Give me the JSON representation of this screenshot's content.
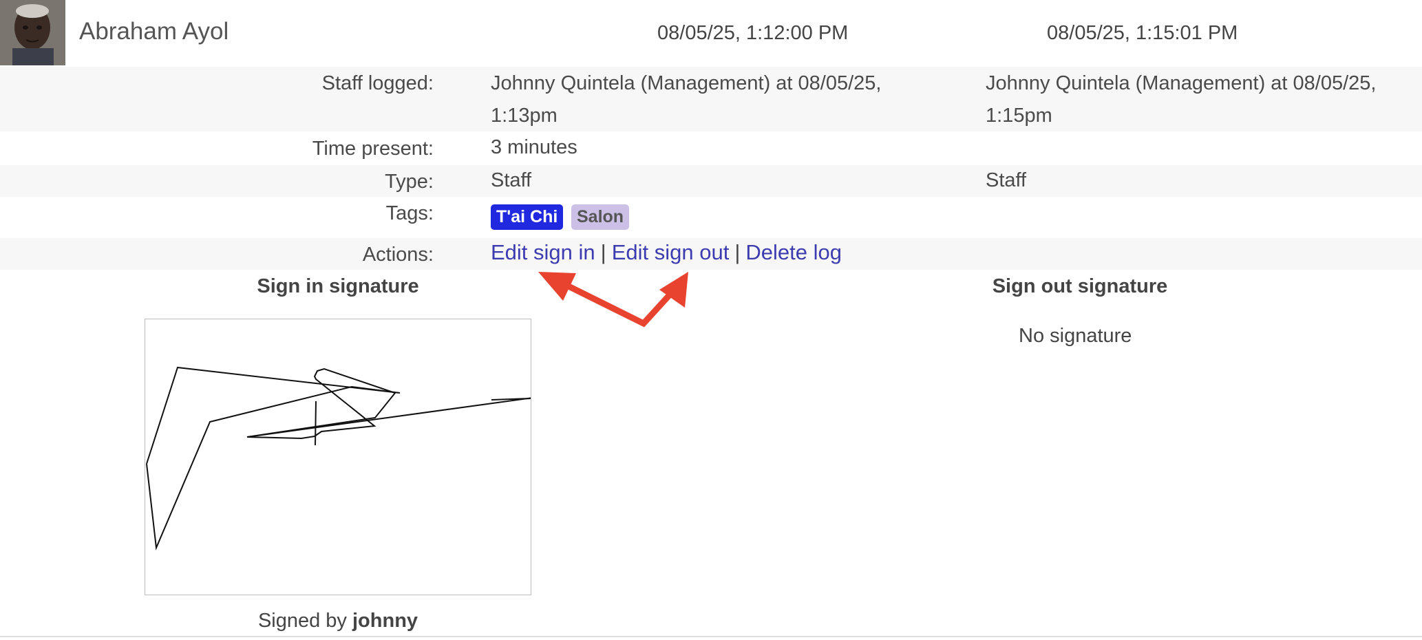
{
  "person": {
    "name": "Abraham Ayol",
    "sign_in_time": "08/05/25, 1:12:00 PM",
    "sign_out_time": "08/05/25, 1:15:01 PM"
  },
  "details": {
    "staff_logged_label": "Staff logged:",
    "staff_logged_in_line1": "Johnny Quintela (Management) at 08/05/25,",
    "staff_logged_in_line2": "1:13pm",
    "staff_logged_out_line1": "Johnny Quintela (Management) at 08/05/25,",
    "staff_logged_out_line2": "1:15pm",
    "time_present_label": "Time present:",
    "time_present_value": "3 minutes",
    "type_label": "Type:",
    "type_in": "Staff",
    "type_out": "Staff",
    "tags_label": "Tags:",
    "tags": [
      "T'ai Chi",
      "Salon"
    ],
    "actions_label": "Actions:",
    "actions": {
      "edit_sign_in": "Edit sign in",
      "edit_sign_out": "Edit sign out",
      "delete_log": "Delete log",
      "separator": "|"
    }
  },
  "signatures": {
    "sign_in_heading": "Sign in signature",
    "sign_out_heading": "Sign out signature",
    "signed_by_prefix": "Signed by",
    "signed_by_user": "johnny",
    "no_signature": "No signature"
  },
  "colors": {
    "link": "#3c3cb0",
    "tag_tai_chi": "#2129e0",
    "tag_salon": "#cdc0e6",
    "annotation_arrow": "#e8432e",
    "row_shade": "#f7f7f7"
  },
  "icons": {
    "annotation": "double-headed-arrow-icon"
  }
}
